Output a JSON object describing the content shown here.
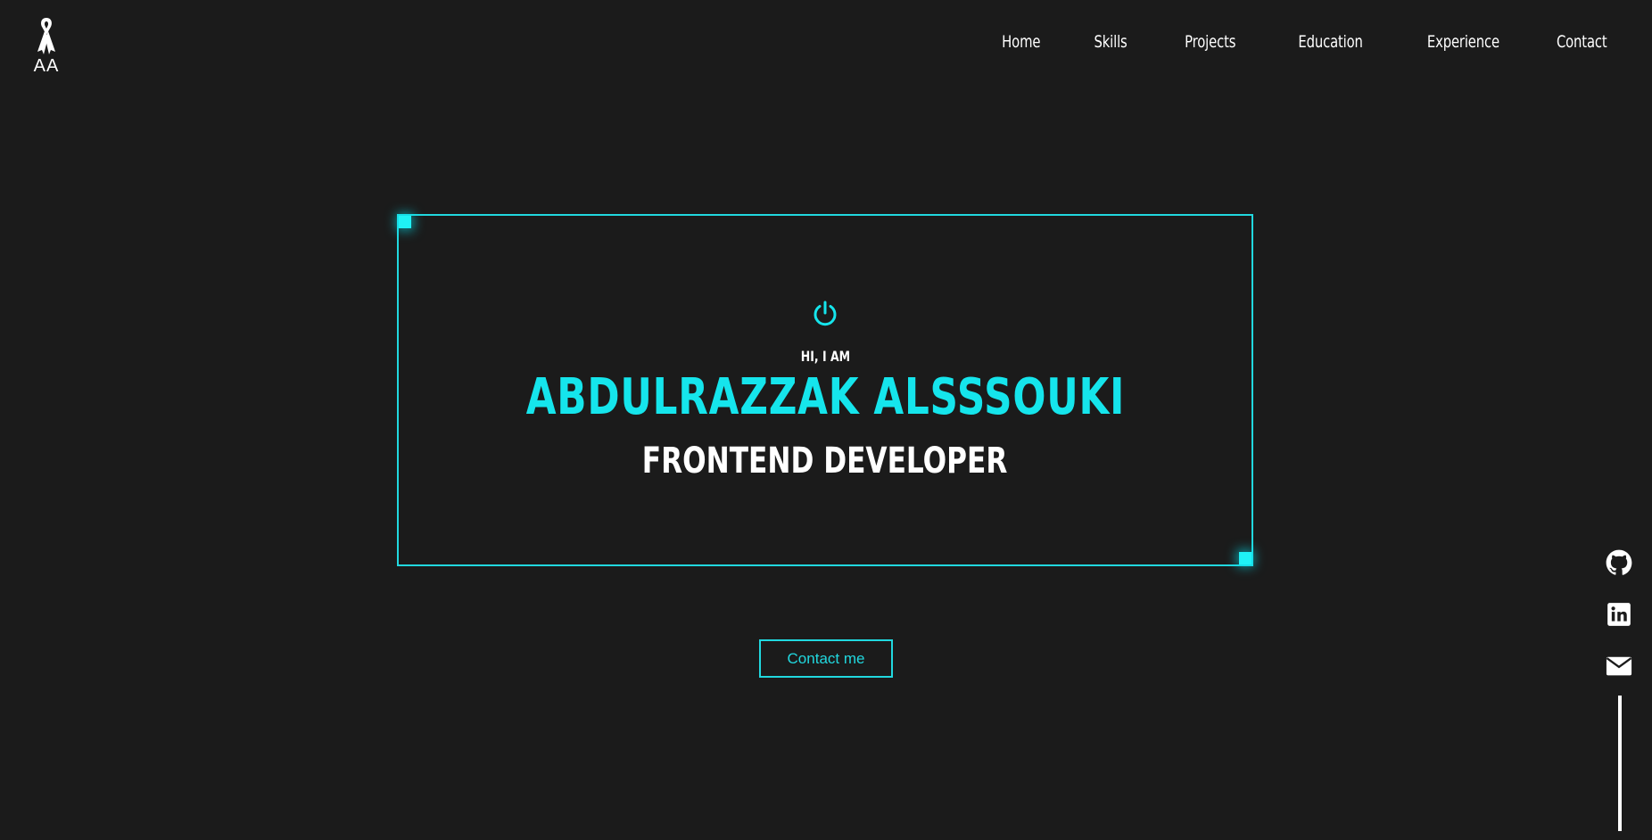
{
  "logo": {
    "text": "AA",
    "icon": "ribbon-icon"
  },
  "nav": {
    "items": [
      {
        "label": "Home"
      },
      {
        "label": "Skills"
      },
      {
        "label": "Projects"
      },
      {
        "label": "Education"
      },
      {
        "label": "Experience"
      },
      {
        "label": "Contact"
      }
    ]
  },
  "hero": {
    "icon": "power-icon",
    "greeting": "HI, I AM",
    "name": "ABDULRAZZAK ALSSSOUKI",
    "role": "FRONTEND DEVELOPER",
    "cta_label": "Contact me"
  },
  "social": {
    "icons": [
      "github-icon",
      "linkedin-icon",
      "mail-icon"
    ]
  },
  "colors": {
    "background": "#1b1b1b",
    "accent": "#15e5ec",
    "text": "#ffffff"
  }
}
